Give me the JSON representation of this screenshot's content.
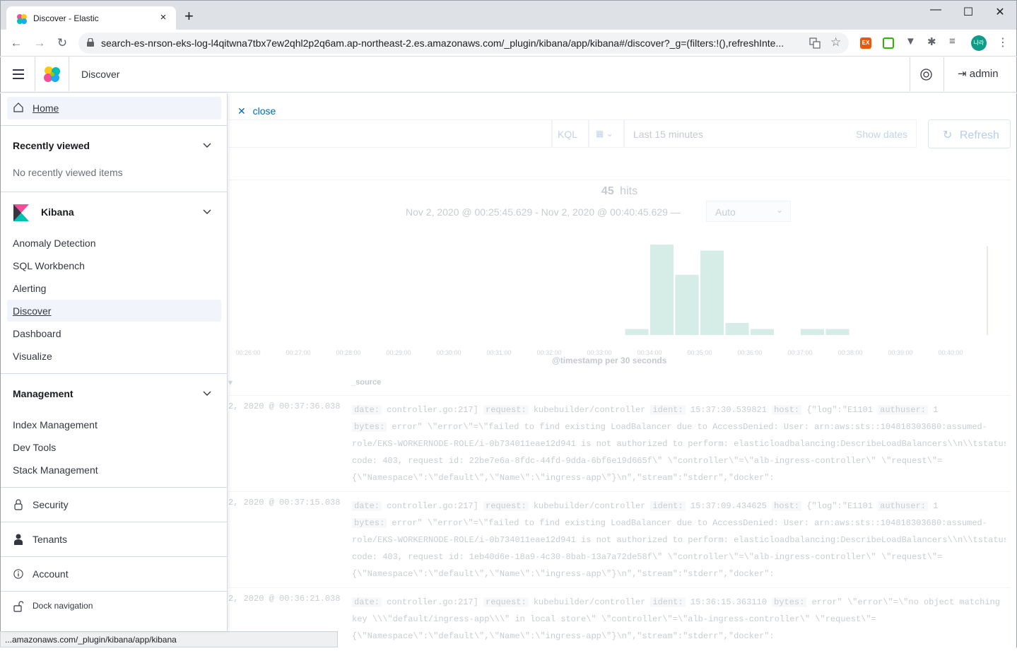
{
  "browser": {
    "tab_title": "Discover - Elastic",
    "tab_close": "×",
    "new_tab": "+",
    "window_minimize": "—",
    "window_maximize": "☐",
    "window_close": "✕",
    "url": "search-es-nrson-eks-log-l4qitwna7tbx7ew2qhl2p2q6am.ap-northeast-2.es.amazonaws.com/_plugin/kibana/app/kibana#/discover?_g=(filters:!(),refreshInte...",
    "status_url": "...amazonaws.com/_plugin/kibana/app/kibana",
    "extensions": [
      "EX",
      "",
      "",
      "",
      "",
      "나라"
    ]
  },
  "header": {
    "page_title": "Discover",
    "user": "admin"
  },
  "query": {
    "close_label": "close",
    "language": "KQL",
    "time_range": "Last 15 minutes",
    "show_dates": "Show dates",
    "refresh": "Refresh"
  },
  "histogram": {
    "hits_count": "45",
    "hits_label": "hits",
    "range_text": "Nov 2, 2020 @ 00:25:45.629 - Nov 2, 2020 @ 00:40:45.629 —",
    "interval": "Auto",
    "x_axis_label": "@timestamp per 30 seconds",
    "ticks": [
      "00:26:00",
      "00:27:00",
      "00:28:00",
      "00:29:00",
      "00:30:00",
      "00:31:00",
      "00:32:00",
      "00:33:00",
      "00:34:00",
      "00:35:00",
      "00:36:00",
      "00:37:00",
      "00:38:00",
      "00:39:00",
      "00:40:00"
    ]
  },
  "chart_data": {
    "type": "bar",
    "title": "",
    "xlabel": "@timestamp per 30 seconds",
    "ylabel": "",
    "categories": [
      "00:33:30",
      "00:34:00",
      "00:34:30",
      "00:35:00",
      "00:35:30",
      "00:36:00",
      "00:36:30",
      "00:37:00",
      "00:37:30"
    ],
    "values": [
      1,
      15,
      10,
      14,
      2,
      1,
      0,
      1,
      1
    ],
    "color": "#d6ece6"
  },
  "table": {
    "time_header": "▾",
    "source_header": "_source",
    "rows": [
      {
        "time": "2, 2020 @ 00:37:36.038",
        "source": [
          [
            {
              "k": "date:"
            },
            {
              "v": " controller.go:217] "
            },
            {
              "k": "request:"
            },
            {
              "v": " kubebuilder/controller "
            },
            {
              "k": "ident:"
            },
            {
              "v": " 15:37:30.539821 "
            },
            {
              "k": "host:"
            },
            {
              "v": " {\"log\":\"E1101 "
            },
            {
              "k": "authuser:"
            },
            {
              "v": " 1"
            }
          ],
          [
            {
              "k": "bytes:"
            },
            {
              "v": " error\" \\\"error\\\"=\\\"failed to find existing LoadBalancer due to AccessDenied: User: arn:aws:sts::104818303680:assumed-"
            }
          ],
          [
            {
              "v": "role/EKS-WORKERNODE-ROLE/i-0b734011eae12d941 is not authorized to perform: elasticloadbalancing:DescribeLoadBalancers\\\\n\\\\tstatus"
            }
          ],
          [
            {
              "v": "code: 403, request id: 22be7e6a-8fdc-44fd-9dda-6bf6e19d665f\\\" \\\"controller\\\"=\\\"alb-ingress-controller\\\" \\\"request\\\"="
            }
          ],
          [
            {
              "v": "{\\\"Namespace\\\":\\\"default\\\",\\\"Name\\\":\\\"ingress-app\\\"}\\n\",\"stream\":\"stderr\",\"docker\":"
            }
          ]
        ]
      },
      {
        "time": "2, 2020 @ 00:37:15.038",
        "source": [
          [
            {
              "k": "date:"
            },
            {
              "v": " controller.go:217] "
            },
            {
              "k": "request:"
            },
            {
              "v": " kubebuilder/controller "
            },
            {
              "k": "ident:"
            },
            {
              "v": " 15:37:09.434625 "
            },
            {
              "k": "host:"
            },
            {
              "v": " {\"log\":\"E1101 "
            },
            {
              "k": "authuser:"
            },
            {
              "v": " 1"
            }
          ],
          [
            {
              "k": "bytes:"
            },
            {
              "v": " error\" \\\"error\\\"=\\\"failed to find existing LoadBalancer due to AccessDenied: User: arn:aws:sts::104818303680:assumed-"
            }
          ],
          [
            {
              "v": "role/EKS-WORKERNODE-ROLE/i-0b734011eae12d941 is not authorized to perform: elasticloadbalancing:DescribeLoadBalancers\\\\n\\\\tstatus"
            }
          ],
          [
            {
              "v": "code: 403, request id: 1eb40d6e-18a9-4c30-8bab-13a7a72de58f\\\" \\\"controller\\\"=\\\"alb-ingress-controller\\\" \\\"request\\\"="
            }
          ],
          [
            {
              "v": "{\\\"Namespace\\\":\\\"default\\\",\\\"Name\\\":\\\"ingress-app\\\"}\\n\",\"stream\":\"stderr\",\"docker\":"
            }
          ]
        ]
      },
      {
        "time": "2, 2020 @ 00:36:21.038",
        "source": [
          [
            {
              "k": "date:"
            },
            {
              "v": " controller.go:217] "
            },
            {
              "k": "request:"
            },
            {
              "v": " kubebuilder/controller "
            },
            {
              "k": "ident:"
            },
            {
              "v": " 15:36:15.363110 "
            },
            {
              "k": "bytes:"
            },
            {
              "v": " error\" \\\"error\\\"=\\\"no object matching"
            }
          ],
          [
            {
              "v": "key \\\\\\\"default/ingress-app\\\\\\\" in local store\\\" \\\"controller\\\"=\\\"alb-ingress-controller\\\" \\\"request\\\"="
            }
          ],
          [
            {
              "v": "{\\\"Namespace\\\":\\\"default\\\",\\\"Name\\\":\\\"ingress-app\\\"}\\n\",\"stream\":\"stderr\",\"docker\":"
            }
          ]
        ]
      }
    ]
  },
  "nav": {
    "home": "Home",
    "recent_title": "Recently viewed",
    "recent_empty": "No recently viewed items",
    "kibana_title": "Kibana",
    "kibana_items": [
      "Anomaly Detection",
      "SQL Workbench",
      "Alerting",
      "Discover",
      "Dashboard",
      "Visualize"
    ],
    "management_title": "Management",
    "management_items": [
      "Index Management",
      "Dev Tools",
      "Stack Management"
    ],
    "security": "Security",
    "tenants": "Tenants",
    "account": "Account",
    "dock": "Dock navigation"
  }
}
